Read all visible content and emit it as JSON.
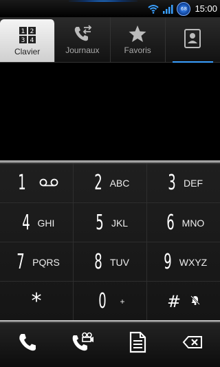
{
  "statusbar": {
    "time": "15:00",
    "battery_level": "68",
    "wifi_icon": "wifi-icon",
    "signal_icon": "signal-icon"
  },
  "tabs": [
    {
      "label": "Clavier",
      "icon": "dialpad-icon",
      "active": true
    },
    {
      "label": "Journaux",
      "icon": "call-log-icon",
      "active": false
    },
    {
      "label": "Favoris",
      "icon": "star-icon",
      "active": false
    },
    {
      "label": "",
      "icon": "contacts-icon",
      "active": false
    }
  ],
  "keys": [
    {
      "digit": "1",
      "letters": "",
      "extra": "voicemail-icon"
    },
    {
      "digit": "2",
      "letters": "ABC"
    },
    {
      "digit": "3",
      "letters": "DEF"
    },
    {
      "digit": "4",
      "letters": "GHI"
    },
    {
      "digit": "5",
      "letters": "JKL"
    },
    {
      "digit": "6",
      "letters": "MNO"
    },
    {
      "digit": "7",
      "letters": "PQRS"
    },
    {
      "digit": "8",
      "letters": "TUV"
    },
    {
      "digit": "9",
      "letters": "WXYZ"
    },
    {
      "digit": "*",
      "letters": ""
    },
    {
      "digit": "0",
      "letters": "+"
    },
    {
      "digit": "#",
      "letters": "",
      "extra": "silent-icon"
    }
  ],
  "actions": [
    {
      "name": "call-icon"
    },
    {
      "name": "video-call-icon"
    },
    {
      "name": "sms-icon"
    },
    {
      "name": "backspace-icon"
    }
  ],
  "colors": {
    "accent": "#3aa0ff",
    "background": "#000000",
    "key_text": "#ffffff"
  }
}
